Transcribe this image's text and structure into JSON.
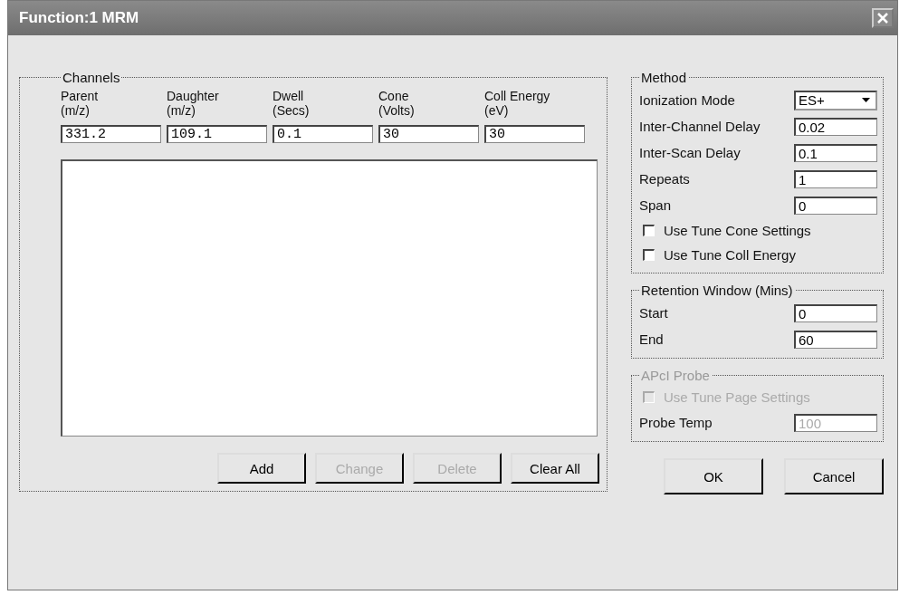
{
  "window": {
    "title": "Function:1 MRM"
  },
  "channels": {
    "title": "Channels",
    "columns": [
      {
        "label": "Parent",
        "unit": "(m/z)",
        "value": "331.2"
      },
      {
        "label": "Daughter",
        "unit": "(m/z)",
        "value": "109.1"
      },
      {
        "label": "Dwell",
        "unit": "(Secs)",
        "value": "0.1"
      },
      {
        "label": "Cone",
        "unit": "(Volts)",
        "value": "30"
      },
      {
        "label": "Coll Energy",
        "unit": "(eV)",
        "value": "30"
      }
    ],
    "buttons": [
      {
        "label": "Add",
        "disabled": false
      },
      {
        "label": "Change",
        "disabled": true
      },
      {
        "label": "Delete",
        "disabled": true
      },
      {
        "label": "Clear All",
        "disabled": false
      }
    ]
  },
  "method": {
    "title": "Method",
    "disabled": false,
    "fields": [
      {
        "kind": "dropdown",
        "label": "Ionization Mode",
        "value": "ES+",
        "disabled": false
      },
      {
        "kind": "text",
        "label": "Inter-Channel Delay",
        "value": "0.02",
        "disabled": false
      },
      {
        "kind": "text",
        "label": "Inter-Scan Delay",
        "value": "0.1",
        "disabled": false
      },
      {
        "kind": "text",
        "label": "Repeats",
        "value": "1",
        "disabled": false
      },
      {
        "kind": "text",
        "label": "Span",
        "value": "0",
        "disabled": false
      },
      {
        "kind": "checkbox",
        "label": "Use Tune Cone Settings",
        "checked": false,
        "disabled": false
      },
      {
        "kind": "checkbox",
        "label": "Use Tune Coll Energy",
        "checked": false,
        "disabled": false
      }
    ]
  },
  "retention": {
    "title": "Retention Window (Mins)",
    "disabled": false,
    "fields": [
      {
        "kind": "text",
        "label": "Start",
        "value": "0",
        "disabled": false
      },
      {
        "kind": "text",
        "label": "End",
        "value": "60",
        "disabled": false
      }
    ]
  },
  "probe": {
    "title": "APcI Probe",
    "disabled": true,
    "fields": [
      {
        "kind": "checkbox",
        "label": "Use Tune Page Settings",
        "checked": false,
        "disabled": true
      },
      {
        "kind": "text",
        "label": "Probe Temp",
        "value": "100",
        "disabled": true
      }
    ]
  },
  "buttons": [
    {
      "label": "OK"
    },
    {
      "label": "Cancel"
    }
  ]
}
